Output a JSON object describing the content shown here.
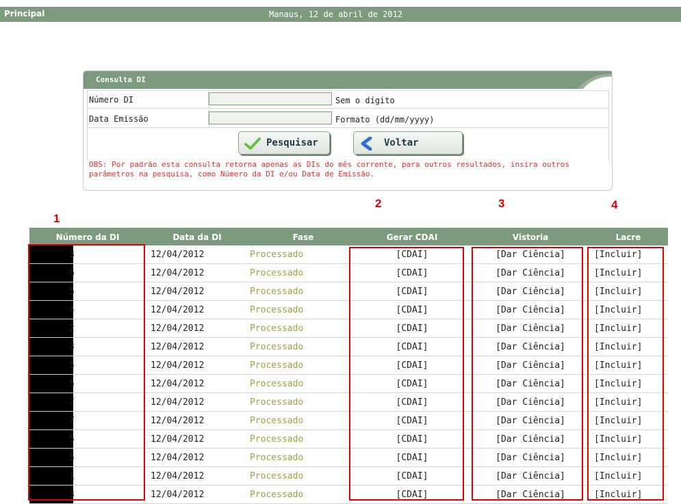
{
  "header": {
    "title": "Principal",
    "date": "Manaus, 12 de abril de 2012"
  },
  "search": {
    "title": "Consulta DI",
    "numero_label": "Número DI",
    "numero_hint": "Sem o dígito",
    "data_label": "Data Emissão",
    "data_hint": "Formato (dd/mm/yyyy)",
    "numero_value": "",
    "data_value": "",
    "pesquisar_label": "Pesquisar",
    "voltar_label": "Voltar",
    "obs": "OBS: Por padrão esta consulta retorna apenas as DIs do mês corrente, para outros resultados, insira outros parâmetros na pesquisa, como Número da DI e/ou Data de Emissão."
  },
  "annotations": [
    "1",
    "2",
    "3",
    "4"
  ],
  "table": {
    "columns": [
      "Número da DI",
      "Data da DI",
      "Fase",
      "Gerar CDAI",
      "Vistoria",
      "Lacre"
    ],
    "rows": [
      {
        "id_tail": "3",
        "date": "12/04/2012",
        "fase": "Processado",
        "cdai": "[CDAI]",
        "vistoria": "[Dar Ciência]",
        "lacre": "[Incluir]"
      },
      {
        "id_tail": "6",
        "date": "12/04/2012",
        "fase": "Processado",
        "cdai": "[CDAI]",
        "vistoria": "[Dar Ciência]",
        "lacre": "[Incluir]"
      },
      {
        "id_tail": "5",
        "date": "12/04/2012",
        "fase": "Processado",
        "cdai": "[CDAI]",
        "vistoria": "[Dar Ciência]",
        "lacre": "[Incluir]"
      },
      {
        "id_tail": "4",
        "date": "12/04/2012",
        "fase": "Processado",
        "cdai": "[CDAI]",
        "vistoria": "[Dar Ciência]",
        "lacre": "[Incluir]"
      },
      {
        "id_tail": "2",
        "date": "12/04/2012",
        "fase": "Processado",
        "cdai": "[CDAI]",
        "vistoria": "[Dar Ciência]",
        "lacre": "[Incluir]"
      },
      {
        "id_tail": "3",
        "date": "12/04/2012",
        "fase": "Processado",
        "cdai": "[CDAI]",
        "vistoria": "[Dar Ciência]",
        "lacre": "[Incluir]"
      },
      {
        "id_tail": "5",
        "date": "12/04/2012",
        "fase": "Processado",
        "cdai": "[CDAI]",
        "vistoria": "[Dar Ciência]",
        "lacre": "[Incluir]"
      },
      {
        "id_tail": "5",
        "date": "12/04/2012",
        "fase": "Processado",
        "cdai": "[CDAI]",
        "vistoria": "[Dar Ciência]",
        "lacre": "[Incluir]"
      },
      {
        "id_tail": "7",
        "date": "12/04/2012",
        "fase": "Processado",
        "cdai": "[CDAI]",
        "vistoria": "[Dar Ciência]",
        "lacre": "[Incluir]"
      },
      {
        "id_tail": "7",
        "date": "12/04/2012",
        "fase": "Processado",
        "cdai": "[CDAI]",
        "vistoria": "[Dar Ciência]",
        "lacre": "[Incluir]"
      },
      {
        "id_tail": "5",
        "date": "12/04/2012",
        "fase": "Processado",
        "cdai": "[CDAI]",
        "vistoria": "[Dar Ciência]",
        "lacre": "[Incluir]"
      },
      {
        "id_tail": "5",
        "date": "12/04/2012",
        "fase": "Processado",
        "cdai": "[CDAI]",
        "vistoria": "[Dar Ciência]",
        "lacre": "[Incluir]"
      },
      {
        "id_tail": "1",
        "date": "12/04/2012",
        "fase": "Processado",
        "cdai": "[CDAI]",
        "vistoria": "[Dar Ciência]",
        "lacre": "[Incluir]"
      },
      {
        "id_tail": "3",
        "date": "12/04/2012",
        "fase": "Processado",
        "cdai": "[CDAI]",
        "vistoria": "[Dar Ciência]",
        "lacre": "[Incluir]"
      }
    ]
  },
  "colors": {
    "header_green": "#7d9a7f",
    "annotation_red": "#e00000",
    "fase_text": "#a0a040",
    "obs_text": "#e03030"
  }
}
